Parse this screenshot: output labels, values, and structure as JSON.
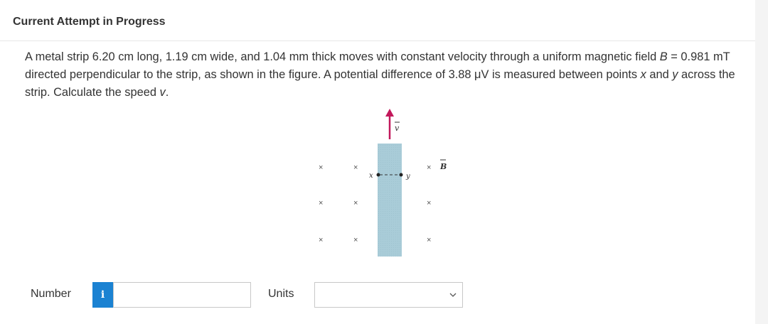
{
  "header": {
    "title": "Current Attempt in Progress"
  },
  "question": {
    "part1": "A metal strip 6.20 cm long, 1.19 cm wide, and 1.04 mm thick moves with constant velocity through a uniform magnetic field ",
    "b_symbol": "B",
    "part2": " = 0.981 mT directed perpendicular to the strip, as shown in the figure. A potential difference of 3.88 μV is measured between points ",
    "x_symbol": "x",
    "part3": " and ",
    "y_symbol": "y",
    "part4": " across the strip. Calculate the speed ",
    "v_symbol": "v",
    "part5": "."
  },
  "figure": {
    "cross_glyph": "×",
    "label_v": "v",
    "label_b": "B",
    "label_x": "x",
    "label_y": "y",
    "strip_color": "#a9ccd8",
    "arrow_color": "#c2185b"
  },
  "answer": {
    "number_label": "Number",
    "info_icon_glyph": "i",
    "number_value": "",
    "units_label": "Units",
    "units_value": ""
  }
}
